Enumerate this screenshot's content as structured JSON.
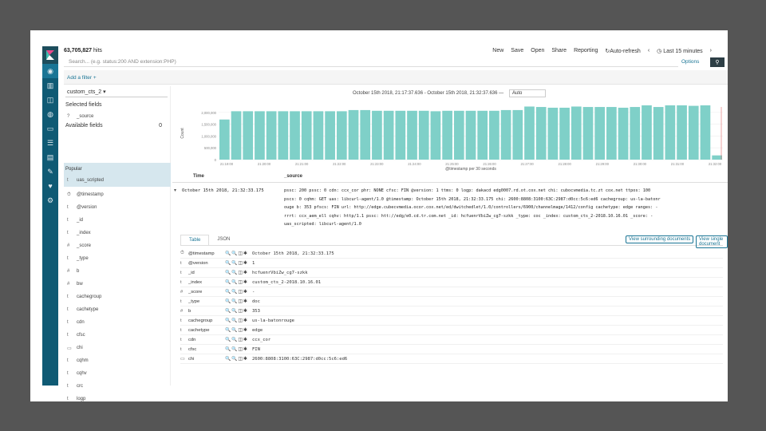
{
  "topbar": {
    "hits_count": "63,705,827",
    "hits_suffix": "hits",
    "menu": [
      "New",
      "Save",
      "Open",
      "Share",
      "Reporting",
      "Auto-refresh",
      "‹",
      "Last 15 minutes",
      "›"
    ]
  },
  "query": {
    "placeholder": "Search... (e.g. status:200 AND extension:PHP)",
    "options_label": "Options",
    "search_icon": "search-icon"
  },
  "filter": {
    "add_label": "Add a filter +"
  },
  "sidebar": {
    "index_pattern": "custom_cts_2 ▾",
    "selected_label": "Selected fields",
    "selected": [
      {
        "type": "?",
        "name": "_source"
      }
    ],
    "available_label": "Available fields",
    "available_count": "0",
    "popular_label": "Popular",
    "popular": [
      {
        "type": "t",
        "name": "uas_scripted"
      }
    ],
    "fields": [
      {
        "type": "⏱",
        "name": "@timestamp"
      },
      {
        "type": "t",
        "name": "@version"
      },
      {
        "type": "t",
        "name": "_id"
      },
      {
        "type": "t",
        "name": "_index"
      },
      {
        "type": "#",
        "name": "_score"
      },
      {
        "type": "t",
        "name": "_type"
      },
      {
        "type": "#",
        "name": "b"
      },
      {
        "type": "#",
        "name": "bw"
      },
      {
        "type": "t",
        "name": "cachegroup"
      },
      {
        "type": "t",
        "name": "cachetype"
      },
      {
        "type": "t",
        "name": "cdn"
      },
      {
        "type": "t",
        "name": "cfsc"
      },
      {
        "type": "▭",
        "name": "chi"
      },
      {
        "type": "t",
        "name": "cqhm"
      },
      {
        "type": "t",
        "name": "cqhv"
      },
      {
        "type": "t",
        "name": "crc"
      },
      {
        "type": "t",
        "name": "logp"
      },
      {
        "type": "t",
        "name": "phr"
      }
    ]
  },
  "main": {
    "time_range": "October 15th 2018, 21:17:37.636 - October 15th 2018, 21:32:37.636 —",
    "interval": "Auto",
    "col_time": "Time",
    "col_source": "_source",
    "doc_time": "October 15th 2018, 21:32:33.175",
    "doc_source_line1": "pssc: 200  pssc: 0  cdn: ccx_cor  phr: NONE  cfsc: FIN  @version: 1  ttms: 0  logp: dakacd edg0007.rd.ot.cox.net  chi: cubocvmedia.tc.zt cox.net  ttpos: 100",
    "doc_source_line2": "pscs: 0  cqhm: GET  uas: libcurl-agent/1.0  @timestamp: October 15th 2018, 21:32:33.175  chi: 2600:8808:3100:63C:2987:d0cc:5c6:ed6  cachegroup: us-la-batonr",
    "doc_source_line3": "ouge  b: 353  pfscs: FIN  url: http://edge.cubecvmedia.ocor.cox.net/ed/dwitchedlet/1.0/controllers/6900/channelmage/1412/config  cachetype: edge  ranges: -",
    "doc_source_line4": "rrrt: ccx_aem_ell  cqhv: http/1.1  pssc: htt://edg/e0.cd.tr.com.net  _id: hcfuenrVbiZw_cg7-szkk  _type: coc  _index: custom_cts_2-2018.10.16.01  _score: -",
    "doc_source_line5": "uas_scripted: libcurl-agent/1.0",
    "tab_table": "Table",
    "tab_json": "JSON",
    "link_surrounding": "View surrounding documents",
    "link_single": "View single document",
    "actions": "🔍🔍◫✱",
    "details": [
      {
        "type": "⏱",
        "name": "@timestamp",
        "value": "October 15th 2018, 21:32:33.175"
      },
      {
        "type": "t",
        "name": "@version",
        "value": "1"
      },
      {
        "type": "t",
        "name": "_id",
        "value": "hcfuenrVbiZw_cg7-szkk"
      },
      {
        "type": "t",
        "name": "_index",
        "value": "custom_cts_2-2018.10.16.01"
      },
      {
        "type": "#",
        "name": "_score",
        "value": "-"
      },
      {
        "type": "t",
        "name": "_type",
        "value": "doc"
      },
      {
        "type": "#",
        "name": "b",
        "value": "353"
      },
      {
        "type": "t",
        "name": "cachegroup",
        "value": "us-la-batonrouge"
      },
      {
        "type": "t",
        "name": "cachetype",
        "value": "edge"
      },
      {
        "type": "t",
        "name": "cdn",
        "value": "ccx_cor"
      },
      {
        "type": "t",
        "name": "cfsc",
        "value": "FIN"
      },
      {
        "type": "▭",
        "name": "chi",
        "value": "2600:8808:3100:63C:2987:d0cc:5c6:ed6"
      }
    ]
  },
  "colors": {
    "rail": "#0f5a74",
    "bar": "#7fd0c8",
    "accent": "#1a7595"
  },
  "chart_data": {
    "type": "bar",
    "ylabel": "Count",
    "xlabel": "@timestamp per 30 seconds",
    "yticks": [
      "0",
      "500,000",
      "1,000,000",
      "1,500,000",
      "2,000,000"
    ],
    "ylim": [
      0,
      2500000
    ],
    "xticks": [
      "21:19:00",
      "21:20:00",
      "21:21:00",
      "21:22:00",
      "21:23:00",
      "21:24:00",
      "21:25:00",
      "21:26:00",
      "21:27:00",
      "21:28:00",
      "21:29:00",
      "21:30:00",
      "21:31:00",
      "21:32:00"
    ],
    "values": [
      1700000,
      2050000,
      2050000,
      2050000,
      2050000,
      2050000,
      2050000,
      2050000,
      2050000,
      2050000,
      2050000,
      2100000,
      2100000,
      2070000,
      2070000,
      2070000,
      2070000,
      2070000,
      2050000,
      2070000,
      2070000,
      2070000,
      2070000,
      2070000,
      2100000,
      2100000,
      2250000,
      2230000,
      2200000,
      2200000,
      2250000,
      2230000,
      2230000,
      2230000,
      2200000,
      2230000,
      2300000,
      2230000,
      2300000,
      2300000,
      2280000,
      2300000,
      180000
    ],
    "grid": true
  }
}
